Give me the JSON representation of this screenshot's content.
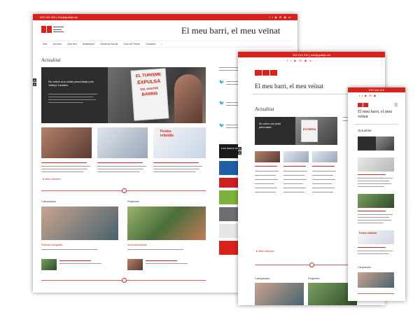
{
  "site": {
    "title": "El meu barri, el meu veïnat",
    "contact": "933 244 910 | info@grafiqt.cat",
    "social_icons": [
      "facebook-icon",
      "twitter-icon",
      "youtube-icon",
      "mail-icon",
      "rss-icon",
      "linkedin-icon"
    ]
  },
  "nav": {
    "items": [
      "Inici",
      "Qui som",
      "Què fem",
      "Mostrarium",
      "Dimensió Social",
      "Guia de Feines",
      "Contacte"
    ]
  },
  "desktop": {
    "section_title": "Actualitat",
    "hero_caption": "No volem una ciutat presoniada pels 'lobbys' turístics",
    "hero_signs": [
      "EL TURISME",
      "EXPULSA",
      "DEL NOSTRE",
      "BARRIS"
    ],
    "more_label": "Més notícies",
    "campaigns_title": "Campanyes",
    "projects_title": "Projectes",
    "campaign_item": "Pobresa energètica",
    "project_item": "Acció intercultural",
    "sidebar_label": "Les doncs de moviment"
  },
  "tablet": {
    "section_title": "Actualitat",
    "hero_caption": "No volem una ciutat presoniada...",
    "hero_sign": "EXTREPA",
    "more_label": "Més notícies",
    "campaigns_title": "Campanyes",
    "projects_title": "Projectes"
  },
  "phone": {
    "section_title": "Actualitat",
    "tagline": "El meu barri, el meu veïnat",
    "contact": "933 244 910",
    "campaigns_title": "Campanyes",
    "festa": "Festes infantils"
  },
  "colors": {
    "accent": "#d9221c",
    "text": "#333333"
  }
}
